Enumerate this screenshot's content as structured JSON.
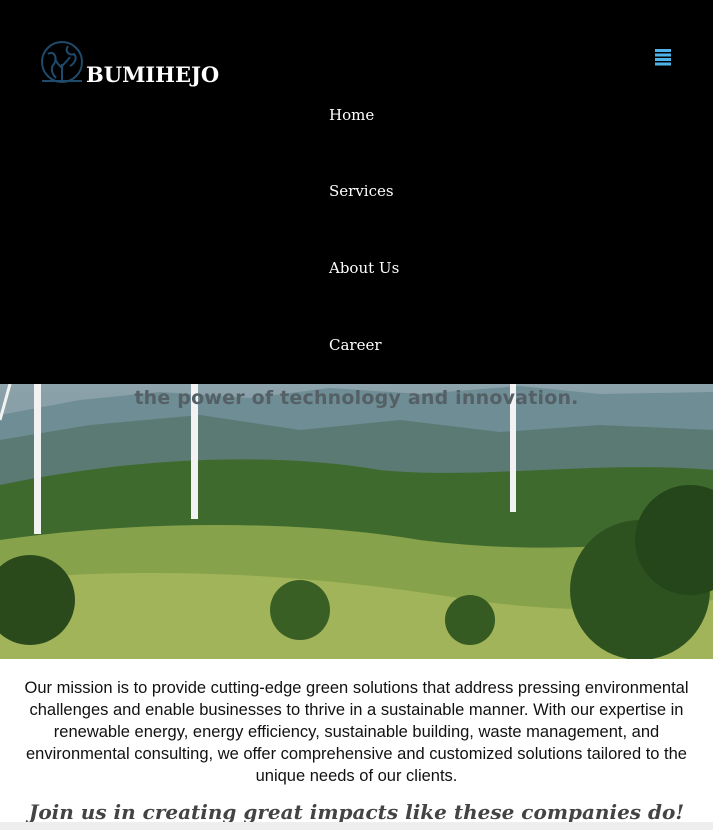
{
  "header": {
    "brand": "BUMIHEJO",
    "logo_icon": "globe-leaf-icon",
    "menu_icon": "hamburger-menu-icon"
  },
  "nav": {
    "items": [
      {
        "label": "Home"
      },
      {
        "label": "Services"
      },
      {
        "label": "About Us"
      },
      {
        "label": "Career"
      }
    ]
  },
  "hero": {
    "tagline": "the power of technology and innovation."
  },
  "mission": {
    "text": "Our mission is to provide cutting-edge green solutions that address pressing environmental challenges and enable businesses to thrive in a sustainable manner. With our expertise in renewable energy, energy efficiency, sustainable building, waste management, and environmental consulting, we offer comprehensive and customized solutions tailored to the unique needs of our clients."
  },
  "partners": {
    "heading": "Join us in creating great impacts like these companies do!"
  },
  "colors": {
    "navbar_bg": "#000000",
    "logo_accent": "#1e4a6b",
    "menu_icon": "#4fb3e8"
  }
}
